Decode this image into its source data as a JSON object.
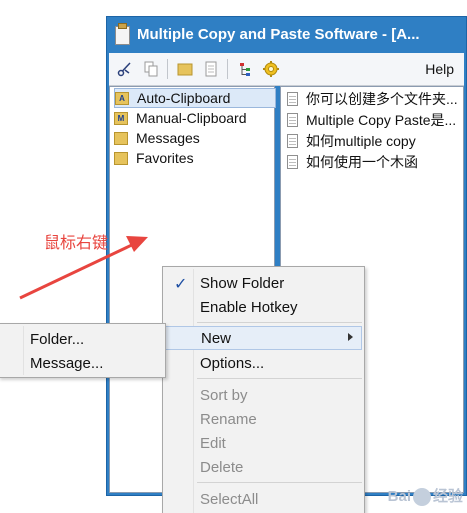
{
  "window": {
    "title": "Multiple Copy and Paste Software - [A...",
    "accent_color": "#2f7fc4"
  },
  "toolbar": {
    "buttons": [
      {
        "icon": "scissors-icon"
      },
      {
        "icon": "copy-icon"
      },
      {
        "icon": "folder-icon"
      },
      {
        "icon": "document-icon"
      },
      {
        "icon": "tree-icon"
      },
      {
        "icon": "gear-icon"
      }
    ],
    "help_label": "Help"
  },
  "tree": {
    "items": [
      {
        "label": "Auto-Clipboard",
        "badge": "A",
        "selected": true
      },
      {
        "label": "Manual-Clipboard",
        "badge": "M",
        "selected": false
      },
      {
        "label": "Messages",
        "badge": "",
        "selected": false
      },
      {
        "label": "Favorites",
        "badge": "",
        "selected": false
      }
    ]
  },
  "list": {
    "items": [
      {
        "label": "你可以创建多个文件夹..."
      },
      {
        "label": "Multiple Copy Paste是..."
      },
      {
        "label": "如何multiple copy"
      },
      {
        "label": "如何使用一个木函"
      }
    ]
  },
  "annotation": {
    "text": "鼠标右键",
    "color": "#e8453f"
  },
  "context_menu": {
    "items": [
      {
        "label": "Show Folder",
        "checked": true,
        "enabled": true
      },
      {
        "label": "Enable Hotkey",
        "checked": false,
        "enabled": true
      },
      {
        "label": "New",
        "has_submenu": true,
        "highlighted": true,
        "enabled": true
      },
      {
        "label": "Options...",
        "enabled": true
      },
      {
        "label": "Sort by",
        "enabled": false
      },
      {
        "label": "Rename",
        "enabled": false
      },
      {
        "label": "Edit",
        "enabled": false
      },
      {
        "label": "Delete",
        "enabled": false
      },
      {
        "label": "SelectAll",
        "enabled": false
      }
    ]
  },
  "submenu": {
    "items": [
      {
        "label": "Folder..."
      },
      {
        "label": "Message..."
      }
    ]
  },
  "watermark": {
    "text_left": "Bai",
    "text_right": "经验"
  }
}
